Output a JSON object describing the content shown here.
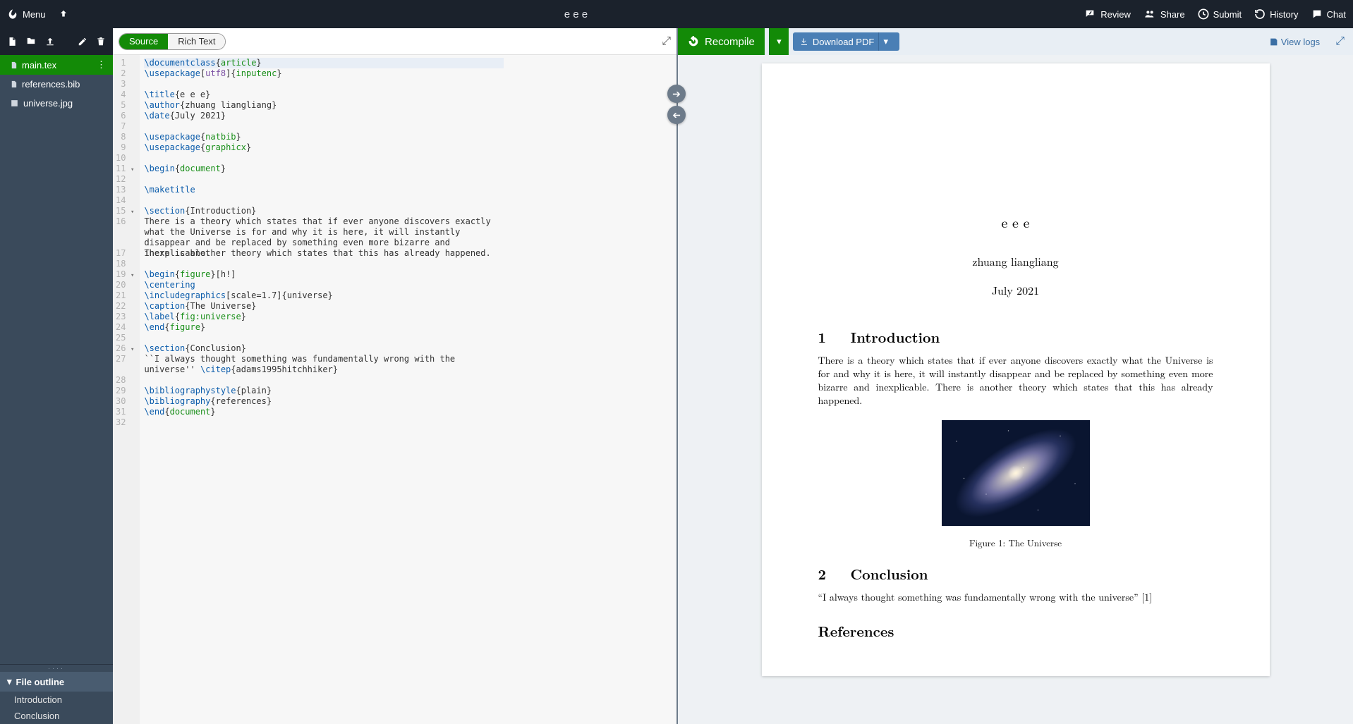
{
  "topbar": {
    "menu": "Menu",
    "project_title": "e e e",
    "review": "Review",
    "share": "Share",
    "submit": "Submit",
    "history": "History",
    "chat": "Chat"
  },
  "sidebar": {
    "files": [
      {
        "name": "main.tex",
        "icon": "file",
        "selected": true
      },
      {
        "name": "references.bib",
        "icon": "file",
        "selected": false
      },
      {
        "name": "universe.jpg",
        "icon": "image",
        "selected": false
      }
    ],
    "outline_header": "File outline",
    "outline": [
      "Introduction",
      "Conclusion"
    ]
  },
  "editor": {
    "mode_source": "Source",
    "mode_rich": "Rich Text",
    "lines": [
      {
        "n": 1,
        "fold": "",
        "segs": [
          [
            "cmd",
            "\\documentclass"
          ],
          [
            "plain",
            "{"
          ],
          [
            "arg",
            "article"
          ],
          [
            "plain",
            "}"
          ]
        ]
      },
      {
        "n": 2,
        "fold": "",
        "segs": [
          [
            "cmd",
            "\\usepackage"
          ],
          [
            "plain",
            "["
          ],
          [
            "opt",
            "utf8"
          ],
          [
            "plain",
            "]{"
          ],
          [
            "arg",
            "inputenc"
          ],
          [
            "plain",
            "}"
          ]
        ]
      },
      {
        "n": 3,
        "fold": "",
        "segs": []
      },
      {
        "n": 4,
        "fold": "",
        "segs": [
          [
            "cmd",
            "\\title"
          ],
          [
            "plain",
            "{e e e}"
          ]
        ]
      },
      {
        "n": 5,
        "fold": "",
        "segs": [
          [
            "cmd",
            "\\author"
          ],
          [
            "plain",
            "{zhuang liangliang}"
          ]
        ]
      },
      {
        "n": 6,
        "fold": "",
        "segs": [
          [
            "cmd",
            "\\date"
          ],
          [
            "plain",
            "{July 2021}"
          ]
        ]
      },
      {
        "n": 7,
        "fold": "",
        "segs": []
      },
      {
        "n": 8,
        "fold": "",
        "segs": [
          [
            "cmd",
            "\\usepackage"
          ],
          [
            "plain",
            "{"
          ],
          [
            "arg",
            "natbib"
          ],
          [
            "plain",
            "}"
          ]
        ]
      },
      {
        "n": 9,
        "fold": "",
        "segs": [
          [
            "cmd",
            "\\usepackage"
          ],
          [
            "plain",
            "{"
          ],
          [
            "arg",
            "graphicx"
          ],
          [
            "plain",
            "}"
          ]
        ]
      },
      {
        "n": 10,
        "fold": "",
        "segs": []
      },
      {
        "n": 11,
        "fold": "▾",
        "segs": [
          [
            "cmd",
            "\\begin"
          ],
          [
            "plain",
            "{"
          ],
          [
            "arg",
            "document"
          ],
          [
            "plain",
            "}"
          ]
        ]
      },
      {
        "n": 12,
        "fold": "",
        "segs": []
      },
      {
        "n": 13,
        "fold": "",
        "segs": [
          [
            "cmd",
            "\\maketitle"
          ]
        ]
      },
      {
        "n": 14,
        "fold": "",
        "segs": []
      },
      {
        "n": 15,
        "fold": "▾",
        "segs": [
          [
            "cmd",
            "\\section"
          ],
          [
            "plain",
            "{Introduction}"
          ]
        ]
      },
      {
        "n": 16,
        "fold": "",
        "segs": [
          [
            "plain",
            "There is a theory which states that if ever anyone discovers exactly what the Universe is for and why it is here, it will instantly disappear and be replaced by something even more bizarre and inexplicable."
          ]
        ]
      },
      {
        "n": 17,
        "fold": "",
        "segs": [
          [
            "plain",
            "There is another theory which states that this has already happened."
          ]
        ]
      },
      {
        "n": 18,
        "fold": "",
        "segs": []
      },
      {
        "n": 19,
        "fold": "▾",
        "segs": [
          [
            "cmd",
            "\\begin"
          ],
          [
            "plain",
            "{"
          ],
          [
            "arg",
            "figure"
          ],
          [
            "plain",
            "}[h!]"
          ]
        ]
      },
      {
        "n": 20,
        "fold": "",
        "segs": [
          [
            "cmd",
            "\\centering"
          ]
        ]
      },
      {
        "n": 21,
        "fold": "",
        "segs": [
          [
            "cmd",
            "\\includegraphics"
          ],
          [
            "plain",
            "[scale=1.7]{universe}"
          ]
        ]
      },
      {
        "n": 22,
        "fold": "",
        "segs": [
          [
            "cmd",
            "\\caption"
          ],
          [
            "plain",
            "{The Universe}"
          ]
        ]
      },
      {
        "n": 23,
        "fold": "",
        "segs": [
          [
            "cmd",
            "\\label"
          ],
          [
            "plain",
            "{"
          ],
          [
            "arg",
            "fig:universe"
          ],
          [
            "plain",
            "}"
          ]
        ]
      },
      {
        "n": 24,
        "fold": "",
        "segs": [
          [
            "cmd",
            "\\end"
          ],
          [
            "plain",
            "{"
          ],
          [
            "arg",
            "figure"
          ],
          [
            "plain",
            "}"
          ]
        ]
      },
      {
        "n": 25,
        "fold": "",
        "segs": []
      },
      {
        "n": 26,
        "fold": "▾",
        "segs": [
          [
            "cmd",
            "\\section"
          ],
          [
            "plain",
            "{Conclusion}"
          ]
        ]
      },
      {
        "n": 27,
        "fold": "",
        "segs": [
          [
            "plain",
            "``I always thought something was fundamentally wrong with the universe'' "
          ],
          [
            "cmd",
            "\\citep"
          ],
          [
            "plain",
            "{adams1995hitchhiker}"
          ]
        ]
      },
      {
        "n": 28,
        "fold": "",
        "segs": []
      },
      {
        "n": 29,
        "fold": "",
        "segs": [
          [
            "cmd",
            "\\bibliographystyle"
          ],
          [
            "plain",
            "{plain}"
          ]
        ]
      },
      {
        "n": 30,
        "fold": "",
        "segs": [
          [
            "cmd",
            "\\bibliography"
          ],
          [
            "plain",
            "{references}"
          ]
        ]
      },
      {
        "n": 31,
        "fold": "",
        "segs": [
          [
            "cmd",
            "\\end"
          ],
          [
            "plain",
            "{"
          ],
          [
            "arg",
            "document"
          ],
          [
            "plain",
            "}"
          ]
        ]
      },
      {
        "n": 32,
        "fold": "",
        "segs": []
      }
    ]
  },
  "preview": {
    "recompile": "Recompile",
    "download": "Download PDF",
    "viewlogs": "View logs",
    "title": "e e e",
    "author": "zhuang liangliang",
    "date": "July 2021",
    "s1_num": "1",
    "s1_title": "Introduction",
    "s1_body": "There is a theory which states that if ever anyone discovers exactly what the Universe is for and why it is here, it will instantly disappear and be replaced by something even more bizarre and inexplicable. There is another theory which states that this has already happened.",
    "fig_caption": "Figure 1: The Universe",
    "s2_num": "2",
    "s2_title": "Conclusion",
    "s2_body": "“I always thought something was fundamentally wrong with the universe” [1]",
    "refs": "References"
  }
}
